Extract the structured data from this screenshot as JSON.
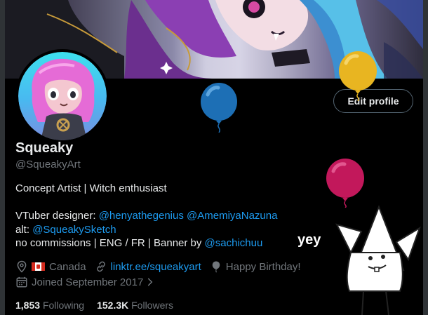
{
  "profile": {
    "display_name": "Squeaky",
    "handle": "@SqueakyArt",
    "edit_button": "Edit profile"
  },
  "bio": {
    "line1": "Concept Artist | Witch enthusiast",
    "line3_prefix": "VTuber designer: ",
    "mention1": "@henyathegenius",
    "mention2": "@AmemiyaNazuna",
    "line4_prefix": "alt: ",
    "mention3": "@SqueakySketch",
    "line5_prefix": "no commissions | ENG / FR | Banner by ",
    "mention4": "@sachichuu"
  },
  "meta": {
    "location": "Canada",
    "website": "linktr.ee/squeakyart",
    "birthday": "Happy Birthday!",
    "joined": "Joined September 2017"
  },
  "stats": {
    "following_count": "1,853",
    "following_label": "Following",
    "followers_count": "152.3K",
    "followers_label": "Followers"
  },
  "decorations": {
    "yey_text": "yey",
    "balloon_colors": [
      "#1d6fb5",
      "#e8b521",
      "#c2185b"
    ]
  },
  "icons": {
    "location": "location-pin-icon",
    "flag": "canada-flag-icon",
    "link": "link-icon",
    "birthday": "balloon-icon",
    "calendar": "calendar-icon",
    "chevron": "chevron-right-icon"
  }
}
